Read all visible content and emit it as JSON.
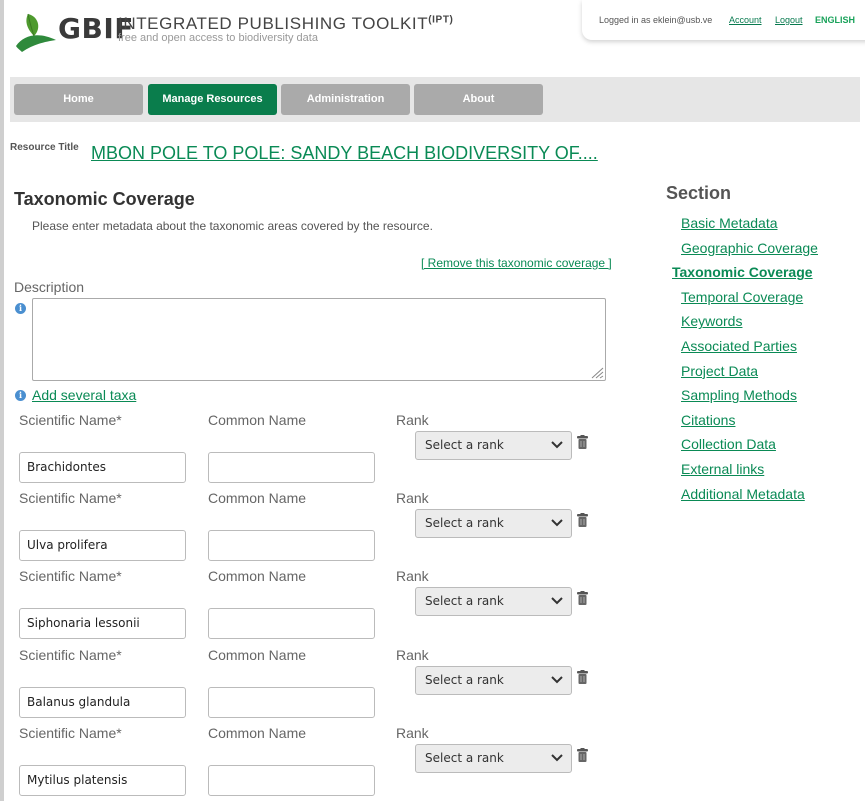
{
  "header": {
    "brand": "GBIF",
    "title": "INTEGRATED PUBLISHING TOOLKIT",
    "title_sup": "(IPT)",
    "subtitle": "free and open access to biodiversity data",
    "logged_in": "Logged in as eklein@usb.ve",
    "account": "Account",
    "logout": "Logout",
    "language": "ENGLISH"
  },
  "nav": [
    "Home",
    "Manage Resources",
    "Administration",
    "About"
  ],
  "nav_active": "Manage Resources",
  "resource": {
    "label": "Resource Title",
    "title": "MBON POLE TO POLE: SANDY BEACH BIODIVERSITY OF...."
  },
  "main": {
    "title": "Taxonomic Coverage",
    "intro": "Please enter metadata about the taxonomic areas covered by the resource.",
    "remove_link": "[ Remove this taxonomic coverage ]",
    "description_label": "Description",
    "description_value": "",
    "add_taxa": "Add several taxa",
    "col_scientific": "Scientific Name*",
    "col_common": "Common Name",
    "col_rank": "Rank",
    "rank_placeholder": "Select a rank",
    "taxa": [
      {
        "scientific": "Brachidontes",
        "common": "",
        "rank": "Select a rank"
      },
      {
        "scientific": "Ulva prolifera",
        "common": "",
        "rank": "Select a rank"
      },
      {
        "scientific": "Siphonaria lessonii",
        "common": "",
        "rank": "Select a rank"
      },
      {
        "scientific": "Balanus glandula",
        "common": "",
        "rank": "Select a rank"
      },
      {
        "scientific": "Mytilus platensis",
        "common": "",
        "rank": "Select a rank"
      }
    ]
  },
  "sidebar": {
    "title": "Section",
    "items": [
      "Basic Metadata",
      "Geographic Coverage",
      "Taxonomic Coverage",
      "Temporal Coverage",
      "Keywords",
      "Associated Parties",
      "Project Data",
      "Sampling Methods",
      "Citations",
      "Collection Data",
      "External links",
      "Additional Metadata"
    ],
    "current": "Taxonomic Coverage"
  },
  "colors": {
    "brand_green": "#0a7d4c",
    "link_green": "#0a8a55",
    "nav_gray": "#aaaaaa"
  },
  "icons": [
    "gbif-leaf-logo",
    "info-icon",
    "chevron-down-icon",
    "trash-icon",
    "resize-grip-icon"
  ]
}
